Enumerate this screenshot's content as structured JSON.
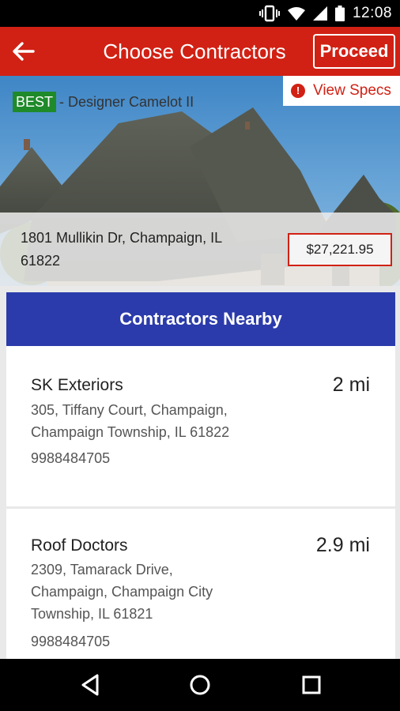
{
  "status_bar": {
    "time": "12:08"
  },
  "app_bar": {
    "title": "Choose Contractors",
    "proceed_label": "Proceed"
  },
  "hero": {
    "badge": "BEST",
    "product_name": "- Designer Camelot II",
    "view_specs_label": "View Specs",
    "info_glyph": "!"
  },
  "property": {
    "address": "1801 Mullikin Dr, Champaign, IL 61822",
    "price": "$27,221.95"
  },
  "nearby": {
    "header": "Contractors Nearby",
    "contractors": [
      {
        "name": "SK Exteriors",
        "distance": "2 mi",
        "address": "305, Tiffany Court, Champaign, Champaign Township, IL 61822",
        "phone": "9988484705"
      },
      {
        "name": "Roof Doctors",
        "distance": "2.9 mi",
        "address": "2309, Tamarack Drive, Champaign, Champaign City Township, IL 61821",
        "phone": "9988484705"
      }
    ]
  },
  "colors": {
    "accent_red": "#d12114",
    "header_blue": "#2b3bab",
    "badge_green": "#1f8a2a"
  }
}
